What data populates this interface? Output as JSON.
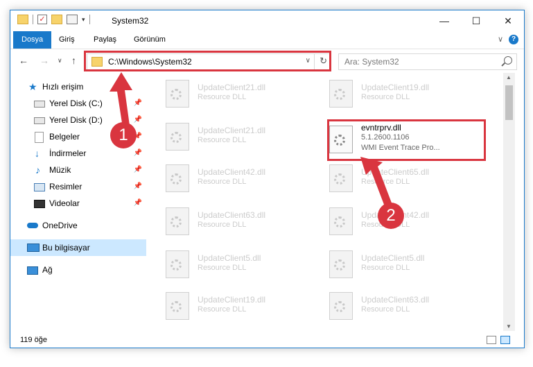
{
  "window": {
    "title": "System32",
    "minimize": "—",
    "maximize": "☐",
    "close": "✕"
  },
  "ribbon": {
    "tabs": [
      "Dosya",
      "Giriş",
      "Paylaş",
      "Görünüm"
    ],
    "active_tab": "Dosya",
    "help": "?"
  },
  "address_bar": {
    "path": "C:\\Windows\\System32",
    "search_placeholder": "Ara: System32"
  },
  "sidebar": {
    "items": [
      {
        "label": "Hızlı erişim",
        "icon": "star-icon",
        "pinned": false
      },
      {
        "label": "Yerel Disk (C:)",
        "icon": "disk-icon",
        "pinned": true
      },
      {
        "label": "Yerel Disk (D:)",
        "icon": "disk-icon",
        "pinned": true
      },
      {
        "label": "Belgeler",
        "icon": "documents-icon",
        "pinned": true
      },
      {
        "label": "İndirmeler",
        "icon": "download-icon",
        "pinned": true
      },
      {
        "label": "Müzik",
        "icon": "music-icon",
        "pinned": true
      },
      {
        "label": "Resimler",
        "icon": "pictures-icon",
        "pinned": true
      },
      {
        "label": "Videolar",
        "icon": "videos-icon",
        "pinned": true
      },
      {
        "label": "OneDrive",
        "icon": "cloud-icon",
        "pinned": false
      },
      {
        "label": "Bu bilgisayar",
        "icon": "computer-icon",
        "pinned": false,
        "selected": true
      },
      {
        "label": "Ağ",
        "icon": "network-icon",
        "pinned": false
      }
    ]
  },
  "files": {
    "left": [
      {
        "name": "UpdateClient21.dll",
        "type": "Resource DLL"
      },
      {
        "name": "UpdateClient21.dll",
        "type": "Resource DLL"
      },
      {
        "name": "UpdateClient42.dll",
        "type": "Resource DLL"
      },
      {
        "name": "UpdateClient63.dll",
        "type": "Resource DLL"
      },
      {
        "name": "UpdateClient5.dll",
        "type": "Resource DLL"
      },
      {
        "name": "UpdateClient19.dll",
        "type": "Resource DLL"
      }
    ],
    "right": [
      {
        "name": "UpdateClient19.dll",
        "type": "Resource DLL"
      },
      {
        "name": "UpdateClient65.dll",
        "type": "Resource DLL"
      },
      {
        "name": "UpdateClient42.dll",
        "type": "Resource DLL"
      },
      {
        "name": "UpdateClient5.dll",
        "type": "Resource DLL"
      },
      {
        "name": "UpdateClient63.dll",
        "type": "Resource DLL"
      }
    ],
    "highlighted": {
      "name": "evntrprv.dll",
      "version": "5.1.2600.1106",
      "description": "WMI Event Trace Pro..."
    }
  },
  "status_bar": {
    "item_count": "119 öğe"
  },
  "annotations": {
    "badge1": "1",
    "badge2": "2",
    "color": "#d9353f"
  }
}
